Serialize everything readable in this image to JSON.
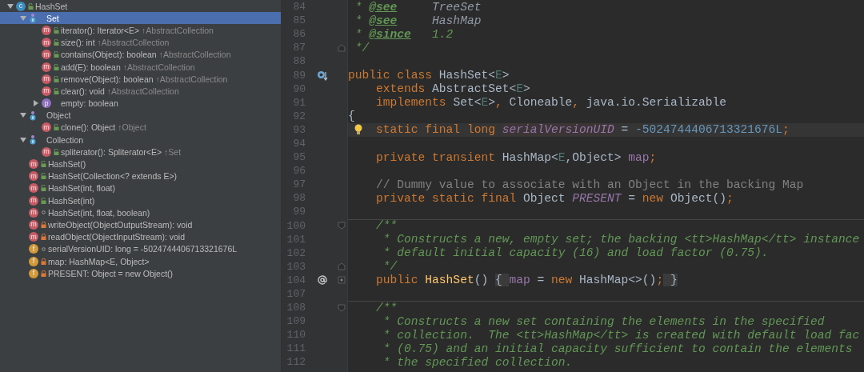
{
  "structure": {
    "items": [
      {
        "label": "HashSet",
        "kind": "class",
        "badge": "c",
        "access": {
          "kind": "public"
        },
        "expanded": true,
        "selected": false,
        "children": [
          {
            "label": "Set",
            "kind": "group",
            "expanded": true,
            "selected": true,
            "children": [
              {
                "label": "iterator(): Iterator<E>",
                "origin": "↑AbstractCollection",
                "kind": "method",
                "badge": "m",
                "access": {
                  "kind": "public"
                },
                "selected": false
              },
              {
                "label": "size(): int",
                "origin": "↑AbstractCollection",
                "kind": "method",
                "badge": "m",
                "access": {
                  "kind": "public"
                },
                "selected": false
              },
              {
                "label": "contains(Object): boolean",
                "origin": "↑AbstractCollection",
                "kind": "method",
                "badge": "m",
                "access": {
                  "kind": "public"
                },
                "selected": false
              },
              {
                "label": "add(E): boolean",
                "origin": "↑AbstractCollection",
                "kind": "method",
                "badge": "m",
                "access": {
                  "kind": "public"
                },
                "selected": false
              },
              {
                "label": "remove(Object): boolean",
                "origin": "↑AbstractCollection",
                "kind": "method",
                "badge": "m",
                "access": {
                  "kind": "public"
                },
                "selected": false
              },
              {
                "label": "clear(): void",
                "origin": "↑AbstractCollection",
                "kind": "method",
                "badge": "m",
                "access": {
                  "kind": "public"
                },
                "selected": false
              },
              {
                "label": "empty: boolean",
                "kind": "property",
                "badge": "p",
                "expanded": false,
                "selected": false
              }
            ]
          },
          {
            "label": "Object",
            "kind": "group",
            "expanded": true,
            "selected": false,
            "children": [
              {
                "label": "clone(): Object",
                "origin": "↑Object",
                "kind": "method",
                "badge": "m",
                "access": {
                  "kind": "public"
                },
                "selected": false
              }
            ]
          },
          {
            "label": "Collection",
            "kind": "group",
            "expanded": true,
            "selected": false,
            "children": [
              {
                "label": "spliterator(): Spliterator<E>",
                "origin": "↑Set",
                "kind": "method",
                "badge": "m",
                "access": {
                  "kind": "public"
                },
                "selected": false
              }
            ]
          },
          {
            "label": "HashSet()",
            "kind": "method",
            "badge": "m",
            "access": {
              "kind": "public"
            },
            "selected": false
          },
          {
            "label": "HashSet(Collection<? extends E>)",
            "kind": "method",
            "badge": "m",
            "access": {
              "kind": "public"
            },
            "selected": false
          },
          {
            "label": "HashSet(int, float)",
            "kind": "method",
            "badge": "m",
            "access": {
              "kind": "public"
            },
            "selected": false
          },
          {
            "label": "HashSet(int)",
            "kind": "method",
            "badge": "m",
            "access": {
              "kind": "public"
            },
            "selected": false
          },
          {
            "label": "HashSet(int, float, boolean)",
            "kind": "method",
            "badge": "m",
            "access": {
              "kind": "package"
            },
            "selected": false
          },
          {
            "label": "writeObject(ObjectOutputStream): void",
            "kind": "method",
            "badge": "m",
            "access": {
              "kind": "private"
            },
            "selected": false
          },
          {
            "label": "readObject(ObjectInputStream): void",
            "kind": "method",
            "badge": "m",
            "access": {
              "kind": "private"
            },
            "selected": false
          },
          {
            "label": "serialVersionUID: long = -5024744406713321676L",
            "kind": "field",
            "badge": "f",
            "access": {
              "kind": "package"
            },
            "selected": false
          },
          {
            "label": "map: HashMap<E, Object>",
            "kind": "field",
            "badge": "f",
            "access": {
              "kind": "private"
            },
            "selected": false
          },
          {
            "label": "PRESENT: Object = new Object()",
            "kind": "field",
            "badge": "f",
            "access": {
              "kind": "private"
            },
            "selected": false
          }
        ]
      }
    ]
  },
  "editor": {
    "lines": [
      {
        "number": "84",
        "tokens": [
          {
            "kind": "doc",
            "text": " * "
          },
          {
            "kind": "doctag",
            "text": "@see"
          },
          {
            "kind": "docref",
            "text": "     TreeSet"
          }
        ]
      },
      {
        "number": "85",
        "tokens": [
          {
            "kind": "doc",
            "text": " * "
          },
          {
            "kind": "doctag",
            "text": "@see"
          },
          {
            "kind": "docref",
            "text": "     HashMap"
          }
        ]
      },
      {
        "number": "86",
        "tokens": [
          {
            "kind": "doc",
            "text": " * "
          },
          {
            "kind": "doctag",
            "text": "@since"
          },
          {
            "kind": "doc",
            "text": "   1.2"
          }
        ]
      },
      {
        "number": "87",
        "fold": {
          "kind": "end"
        },
        "tokens": [
          {
            "kind": "doc",
            "text": " */"
          }
        ]
      },
      {
        "number": "88"
      },
      {
        "number": "89",
        "gutter": {
          "kind": "implemented"
        },
        "tokens": [
          {
            "kind": "kw",
            "text": "public class "
          },
          {
            "kind": "plain",
            "text": "HashSet<"
          },
          {
            "kind": "param",
            "text": "E"
          },
          {
            "kind": "plain",
            "text": ">"
          }
        ]
      },
      {
        "number": "90",
        "tokens": [
          {
            "kind": "kw",
            "text": "    extends "
          },
          {
            "kind": "plain",
            "text": "AbstractSet<"
          },
          {
            "kind": "param",
            "text": "E"
          },
          {
            "kind": "plain",
            "text": ">"
          }
        ]
      },
      {
        "number": "91",
        "tokens": [
          {
            "kind": "kw",
            "text": "    implements "
          },
          {
            "kind": "plain",
            "text": "Set<"
          },
          {
            "kind": "param",
            "text": "E"
          },
          {
            "kind": "plain",
            "text": ">"
          },
          {
            "kind": "kw",
            "text": ", "
          },
          {
            "kind": "plain",
            "text": "Cloneable"
          },
          {
            "kind": "kw",
            "text": ", "
          },
          {
            "kind": "plain",
            "text": "java.io.Serializable"
          }
        ]
      },
      {
        "number": "92",
        "tokens": [
          {
            "kind": "plain",
            "text": "{"
          }
        ]
      },
      {
        "number": "93",
        "current": true,
        "bulb": true,
        "tokens": [
          {
            "kind": "kw",
            "text": "    static final long "
          },
          {
            "kind": "unused",
            "text": "serialVersionUID"
          },
          {
            "kind": "plain",
            "text": " = "
          },
          {
            "kind": "num",
            "text": "-5024744406713321676L"
          },
          {
            "kind": "kw",
            "text": ";"
          }
        ]
      },
      {
        "number": "94"
      },
      {
        "number": "95",
        "tokens": [
          {
            "kind": "kw",
            "text": "    private transient "
          },
          {
            "kind": "plain",
            "text": "HashMap<"
          },
          {
            "kind": "param",
            "text": "E"
          },
          {
            "kind": "plain",
            "text": ",Object> "
          },
          {
            "kind": "field",
            "text": "map"
          },
          {
            "kind": "kw",
            "text": ";"
          }
        ]
      },
      {
        "number": "96"
      },
      {
        "number": "97",
        "tokens": [
          {
            "kind": "comment",
            "text": "    // Dummy value to associate with an Object in the backing Map"
          }
        ]
      },
      {
        "number": "98",
        "tokens": [
          {
            "kind": "kw",
            "text": "    private static final "
          },
          {
            "kind": "plain",
            "text": "Object "
          },
          {
            "kind": "static",
            "text": "PRESENT"
          },
          {
            "kind": "plain",
            "text": " = "
          },
          {
            "kind": "kw",
            "text": "new "
          },
          {
            "kind": "plain",
            "text": "Object()"
          },
          {
            "kind": "kw",
            "text": ";"
          }
        ]
      },
      {
        "number": "99"
      },
      {
        "number": "100",
        "separator": true,
        "fold": {
          "kind": "start"
        },
        "tokens": [
          {
            "kind": "doc",
            "text": "    /**"
          }
        ]
      },
      {
        "number": "101",
        "tokens": [
          {
            "kind": "doc",
            "text": "     * Constructs a new, empty set; the backing <tt>HashMap</tt> instance"
          }
        ]
      },
      {
        "number": "102",
        "tokens": [
          {
            "kind": "doc",
            "text": "     * default initial capacity (16) and load factor (0.75)."
          }
        ]
      },
      {
        "number": "103",
        "fold": {
          "kind": "end"
        },
        "tokens": [
          {
            "kind": "doc",
            "text": "     */"
          }
        ]
      },
      {
        "number": "104",
        "gutter": {
          "kind": "annotation"
        },
        "fold": {
          "kind": "collapsed"
        },
        "tokens": [
          {
            "kind": "kw",
            "text": "    public "
          },
          {
            "kind": "method",
            "text": "HashSet"
          },
          {
            "kind": "plain",
            "text": "() "
          },
          {
            "kind": "folded",
            "text": "{ "
          },
          {
            "kind": "field",
            "text": "map"
          },
          {
            "kind": "plain",
            "text": " = "
          },
          {
            "kind": "kw",
            "text": "new "
          },
          {
            "kind": "plain",
            "text": "HashMap<>()"
          },
          {
            "kind": "kw",
            "text": ";"
          },
          {
            "kind": "folded",
            "text": " }"
          }
        ]
      },
      {
        "number": "107"
      },
      {
        "number": "108",
        "separator": true,
        "fold": {
          "kind": "start"
        },
        "tokens": [
          {
            "kind": "doc",
            "text": "    /**"
          }
        ]
      },
      {
        "number": "109",
        "tokens": [
          {
            "kind": "doc",
            "text": "     * Constructs a new set containing the elements in the specified"
          }
        ]
      },
      {
        "number": "110",
        "tokens": [
          {
            "kind": "doc",
            "text": "     * collection.  The <tt>HashMap</tt> is created with default load fac"
          }
        ]
      },
      {
        "number": "111",
        "tokens": [
          {
            "kind": "doc",
            "text": "     * (0.75) and an initial capacity sufficient to contain the elements"
          }
        ]
      },
      {
        "number": "112",
        "tokens": [
          {
            "kind": "doc",
            "text": "     * the specified collection."
          }
        ]
      }
    ]
  }
}
